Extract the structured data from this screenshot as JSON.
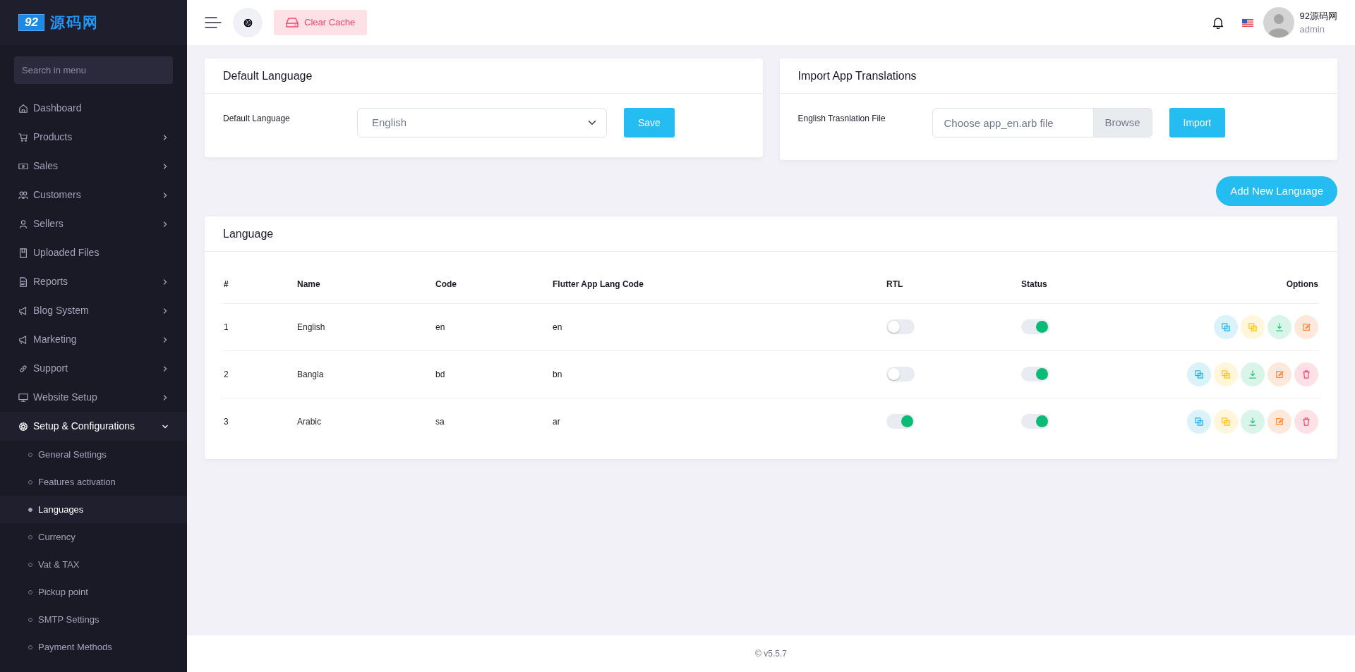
{
  "sidebar": {
    "logo": {
      "badge": "92",
      "text": "源码网"
    },
    "search": {
      "placeholder": "Search in menu"
    },
    "items": [
      {
        "label": "Dashboard",
        "kind": "link"
      },
      {
        "label": "Products",
        "kind": "group",
        "expanded": false
      },
      {
        "label": "Sales",
        "kind": "group",
        "expanded": false
      },
      {
        "label": "Customers",
        "kind": "group",
        "expanded": false
      },
      {
        "label": "Sellers",
        "kind": "group",
        "expanded": false
      },
      {
        "label": "Uploaded Files",
        "kind": "link"
      },
      {
        "label": "Reports",
        "kind": "group",
        "expanded": false
      },
      {
        "label": "Blog System",
        "kind": "group",
        "expanded": false
      },
      {
        "label": "Marketing",
        "kind": "group",
        "expanded": false
      },
      {
        "label": "Support",
        "kind": "group",
        "expanded": false
      },
      {
        "label": "Website Setup",
        "kind": "group",
        "expanded": false
      },
      {
        "label": "Setup & Configurations",
        "kind": "group",
        "expanded": true,
        "children": [
          {
            "label": "General Settings",
            "selected": false
          },
          {
            "label": "Features activation",
            "selected": false
          },
          {
            "label": "Languages",
            "selected": true
          },
          {
            "label": "Currency",
            "selected": false
          },
          {
            "label": "Vat & TAX",
            "selected": false
          },
          {
            "label": "Pickup point",
            "selected": false
          },
          {
            "label": "SMTP Settings",
            "selected": false
          },
          {
            "label": "Payment Methods",
            "selected": false
          }
        ]
      }
    ]
  },
  "header": {
    "clear_cache": "Clear Cache",
    "user": {
      "name": "92源码网",
      "role": "admin"
    }
  },
  "default_language": {
    "title": "Default Language",
    "label": "Default Language",
    "value": "English",
    "save": "Save"
  },
  "import_translations": {
    "title": "Import App Translations",
    "label": "English Trasnlation File",
    "placeholder": "Choose app_en.arb file",
    "browse": "Browse",
    "import": "Import"
  },
  "add_language": "Add New Language",
  "language_table": {
    "title": "Language",
    "columns": [
      "#",
      "Name",
      "Code",
      "Flutter App Lang Code",
      "RTL",
      "Status",
      "Options"
    ],
    "rows": [
      {
        "index": "1",
        "name": "English",
        "code": "en",
        "app_code": "en",
        "rtl": false,
        "status": true,
        "deletable": false
      },
      {
        "index": "2",
        "name": "Bangla",
        "code": "bd",
        "app_code": "bn",
        "rtl": false,
        "status": true,
        "deletable": true
      },
      {
        "index": "3",
        "name": "Arabic",
        "code": "sa",
        "app_code": "ar",
        "rtl": true,
        "status": true,
        "deletable": true
      }
    ]
  },
  "footer": "© v5.5.7"
}
